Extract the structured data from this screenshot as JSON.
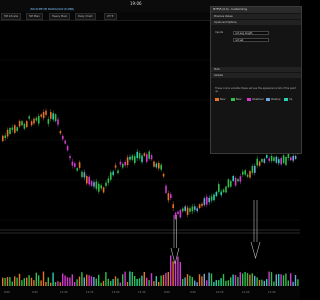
{
  "header": {
    "clock": "19:06"
  },
  "toolbar": {
    "items": [
      "5M Intrade",
      "5M Main",
      "Heavy Main",
      "Daily Chart",
      "2H Tr"
    ]
  },
  "chart_area": {
    "symbol_line": "/NQ:XCME.5M  NASDAQ100 (E-MINI)",
    "time_labels": [
      "9:05",
      "9:45",
      "11:45",
      "12:25",
      "13:05",
      "13:45",
      "9:05",
      "9:45",
      "10:25",
      "11:05",
      "11:45"
    ]
  },
  "dialog": {
    "title": "MTFS5 (6.0) - Customizing",
    "sections": {
      "previous": "Previous Values",
      "inputs": "Inputs and Options",
      "plots": "Plots",
      "globals": "Globals"
    },
    "inputs_label": "Inputs",
    "input_rows": [
      {
        "label": "",
        "field": "not avg length"
      },
      {
        "label": "",
        "field": "not set"
      }
    ],
    "note": "These colors variable these set see the appearance tab of the paint up.",
    "swatches": [
      {
        "label": "Bear",
        "color": "#e8732a"
      },
      {
        "label": "Bear",
        "color": "#2fbf4a"
      },
      {
        "label": "Weakbear",
        "color": "#d23ad2"
      },
      {
        "label": "Weakup",
        "color": "#6fa8d8"
      },
      {
        "label": "Up",
        "color": "#2bd0b0"
      }
    ]
  }
}
